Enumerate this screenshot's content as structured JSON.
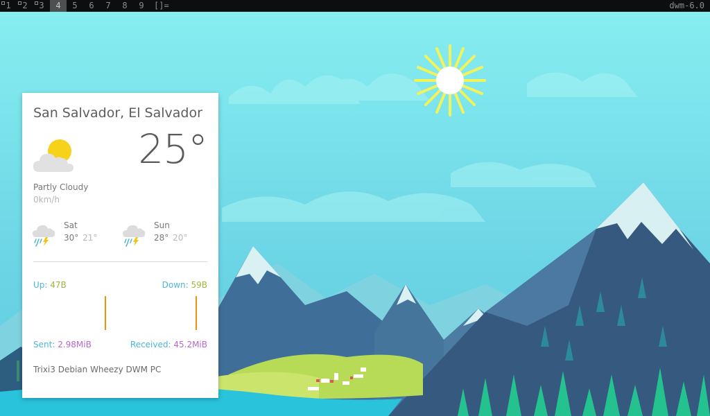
{
  "topbar": {
    "tags": [
      {
        "label": "1",
        "occupied": true
      },
      {
        "label": "2",
        "occupied": true
      },
      {
        "label": "3",
        "occupied": true
      },
      {
        "label": "4",
        "occupied": false,
        "active": true
      },
      {
        "label": "5",
        "occupied": false
      },
      {
        "label": "6",
        "occupied": false
      },
      {
        "label": "7",
        "occupied": false
      },
      {
        "label": "8",
        "occupied": false
      },
      {
        "label": "9",
        "occupied": false
      }
    ],
    "layout_symbol": "[]=",
    "status": "dwm-6.0",
    "colors": {
      "bar_bg": "#0c0e10",
      "active_tag_bg": "#4e4f51",
      "text": "#8d8d8d"
    }
  },
  "weather": {
    "location": "San Salvador, El Salvador",
    "temperature": "25°",
    "icon": "partly-cloudy-icon",
    "condition": "Partly Cloudy",
    "wind": "0km/h",
    "forecast": [
      {
        "day": "Sat",
        "high": "30°",
        "low": "21°",
        "icon": "thunderstorm-icon"
      },
      {
        "day": "Sun",
        "high": "28°",
        "low": "20°",
        "icon": "thunderstorm-icon"
      }
    ]
  },
  "network": {
    "up_label": "Up:",
    "up_value": "47B",
    "down_label": "Down:",
    "down_value": "59B",
    "sent_label": "Sent:",
    "sent_value": "2.98MiB",
    "received_label": "Received:",
    "received_value": "45.2MiB",
    "colors": {
      "label": "#4db6d6",
      "rate": "#9ab83c",
      "total": "#b867cc",
      "graph": "#e8930e"
    }
  },
  "system": {
    "hostname": "Trixi3 Debian Wheezy DWM PC"
  }
}
